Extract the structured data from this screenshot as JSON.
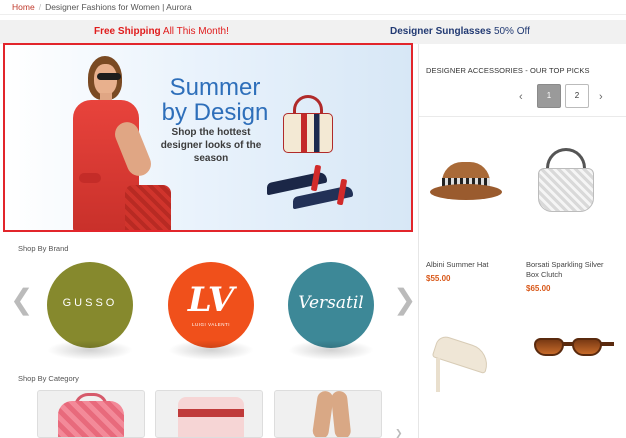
{
  "breadcrumb": {
    "home": "Home",
    "current": "Designer Fashions for Women | Aurora"
  },
  "promo": {
    "left_bold": "Free Shipping",
    "left_rest": "All This Month!",
    "right_bold": "Designer Sunglasses",
    "right_rest": "50% Off"
  },
  "hero": {
    "title_line1": "Summer",
    "title_line2": "by Design",
    "subtitle": "Shop the hottest designer looks of the season"
  },
  "brands": {
    "section_title": "Shop By Brand",
    "items": [
      {
        "name": "GUSSO",
        "color": "#86892d"
      },
      {
        "logo": "LV",
        "name": "LUIGI VALENTI",
        "color": "#f0501b"
      },
      {
        "name": "Versatil",
        "color": "#3d8897"
      }
    ]
  },
  "categories": {
    "section_title": "Shop By Category"
  },
  "sidebar": {
    "title": "DESIGNER ACCESSORIES - OUR TOP PICKS",
    "pages": [
      "1",
      "2"
    ],
    "active_page": "1",
    "products": [
      {
        "name": "Albini Summer Hat",
        "price": "$55.00"
      },
      {
        "name": "Borsati Sparkling Silver Box Clutch",
        "price": "$65.00"
      },
      {
        "name": "",
        "price": ""
      },
      {
        "name": "",
        "price": ""
      }
    ]
  },
  "colors": {
    "accent_red": "#e2252b",
    "price_orange": "#d9591a",
    "promo_navy": "#223a73",
    "hero_blue": "#2e6fba"
  }
}
